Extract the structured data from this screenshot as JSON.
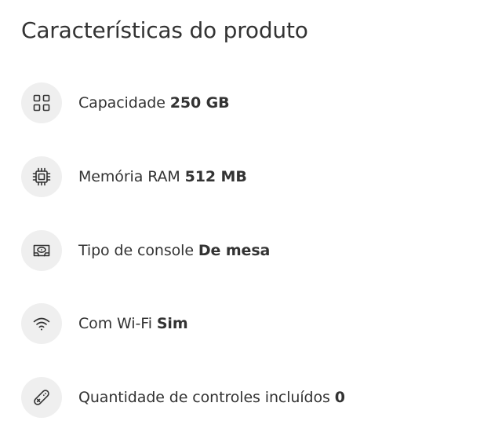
{
  "title": "Características do produto",
  "specs": [
    {
      "label": "Capacidade",
      "value": "250 GB",
      "icon": "grid-icon"
    },
    {
      "label": "Memória RAM",
      "value": "512 MB",
      "icon": "chip-icon"
    },
    {
      "label": "Tipo de console",
      "value": "De mesa",
      "icon": "console-icon"
    },
    {
      "label": "Com Wi-Fi",
      "value": "Sim",
      "icon": "wifi-icon"
    },
    {
      "label": "Quantidade de controles incluídos",
      "value": "0",
      "icon": "controller-icon"
    }
  ],
  "colors": {
    "text": "#333333",
    "icon_background": "#efefef",
    "icon_stroke": "#333333"
  }
}
